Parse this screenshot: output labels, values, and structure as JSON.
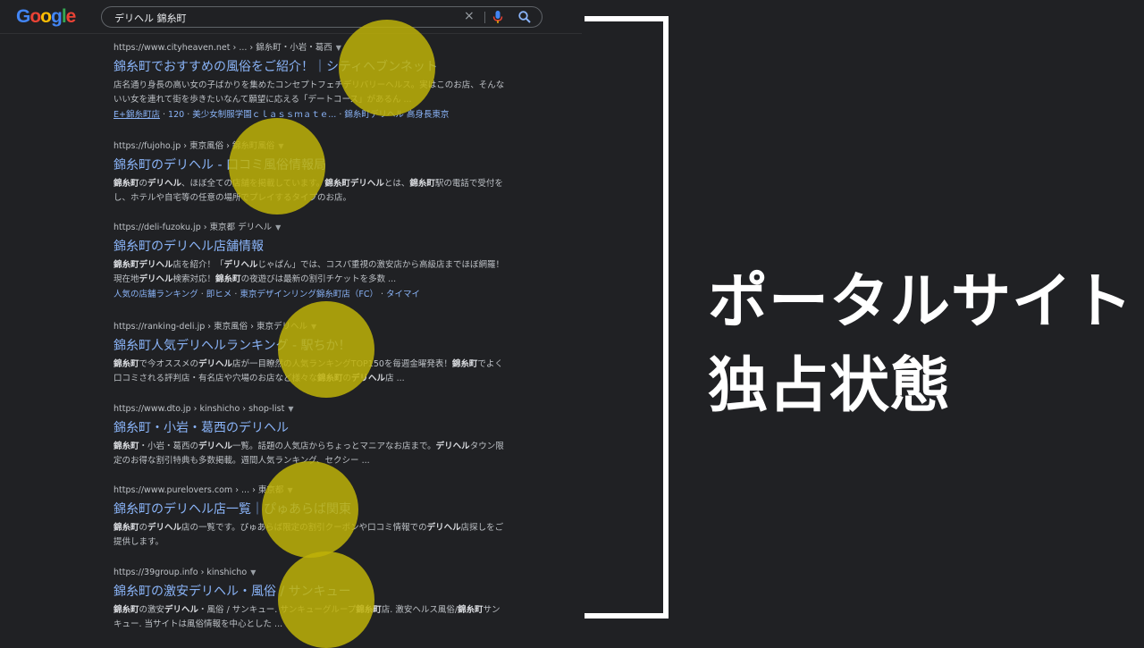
{
  "header": {
    "logo_letters": [
      {
        "ch": "G",
        "color": "#4285f4"
      },
      {
        "ch": "o",
        "color": "#ea4335"
      },
      {
        "ch": "o",
        "color": "#fbbc05"
      },
      {
        "ch": "g",
        "color": "#4285f4"
      },
      {
        "ch": "l",
        "color": "#34a853"
      },
      {
        "ch": "e",
        "color": "#ea4335"
      }
    ],
    "search_query": "デリヘル 錦糸町",
    "clear_glyph": "×",
    "icons": [
      "close-icon",
      "mic-icon",
      "search-icon",
      "gear-icon",
      "apps-icon"
    ]
  },
  "results": [
    {
      "url": "https://www.cityheaven.net › ... › 錦糸町・小岩・葛西",
      "title": "錦糸町でおすすめの風俗をご紹介！｜シティヘブンネット",
      "snippet": "店名通り身長の高い女の子ばかりを集めたコンセプトフェチデリバリーヘルス。実はこのお店、そんないい女を連れて街を歩きたいなんて願望に応える「デートコース」があるん ...",
      "links": [
        "E+錦糸町店",
        "120",
        "美少女制服学園ｃｌａｓｓｍａｔｅ...",
        "錦糸町デリヘル 高身長東京"
      ]
    },
    {
      "url": "https://fujoho.jp › 東京風俗 › 錦糸町風俗",
      "title": "錦糸町のデリヘル - 口コミ風俗情報局",
      "snippet": "<b>錦糸町</b>の<b>デリヘル</b>、ほぼ全ての店舗を掲載しています。<b>錦糸町デリヘル</b>とは、<b>錦糸町</b>駅の電話で受付をし、ホテルや自宅等の任意の場所でプレイするタイプのお店。",
      "links": []
    },
    {
      "url": "https://deli-fuzoku.jp › 東京都 デリヘル",
      "title": "錦糸町のデリヘル店舗情報",
      "snippet": "<b>錦糸町デリヘル</b>店を紹介！「<b>デリヘル</b>じゃぱん」では、コスパ重視の激安店から高級店までほぼ網羅！現在地<b>デリヘル</b>検索対応！<b>錦糸町</b>の夜遊びは最新の割引チケットを多数 ...",
      "links": [
        "人気の店舗ランキング",
        "即ヒメ",
        "東京デザインリング錦糸町店（FC）",
        "タイマイ"
      ]
    },
    {
      "url": "https://ranking-deli.jp › 東京風俗 › 東京デリヘル",
      "title": "錦糸町人気デリヘルランキング - 駅ちか！",
      "snippet": "<b>錦糸町</b>で今オススメの<b>デリヘル</b>店が一目瞭然の人気ランキングTOP150を毎週金曜発表！<b>錦糸町</b>でよく口コミされる評判店・有名店や穴場のお店など様々な<b>錦糸町</b>の<b>デリヘル</b>店 ...",
      "links": []
    },
    {
      "url": "https://www.dto.jp › kinshicho › shop-list",
      "title": "錦糸町・小岩・葛西のデリヘル",
      "snippet": "<b>錦糸町</b>・小岩・葛西の<b>デリヘル</b>一覧。話題の人気店からちょっとマニアなお店まで。<b>デリヘル</b>タウン限定のお得な割引特典も多数掲載。週間人気ランキング、セクシー ...",
      "links": []
    },
    {
      "url": "https://www.purelovers.com › ... › 東京都",
      "title": "錦糸町のデリヘル店一覧｜ぴゅあらば関東",
      "snippet": "<b>錦糸町</b>の<b>デリヘル</b>店の一覧です。ぴゅあらば限定の割引クーポンや口コミ情報での<b>デリヘル</b>店探しをご提供します。",
      "links": []
    },
    {
      "url": "https://39group.info › kinshicho",
      "title": "錦糸町の激安デリヘル・風俗 / サンキュー",
      "snippet": "<b>錦糸町</b>の激安<b>デリヘル</b>・風俗 / サンキュー. サンキューグループ<b>錦糸町</b>店. 激安ヘルス風俗/<b>錦糸町</b>サンキュー. 当サイトは風俗情報を中心とした ...",
      "links": []
    }
  ],
  "overlay": {
    "line1": "ポータルサイト",
    "line2": "独占状態",
    "highlight_color": "#beb208"
  }
}
